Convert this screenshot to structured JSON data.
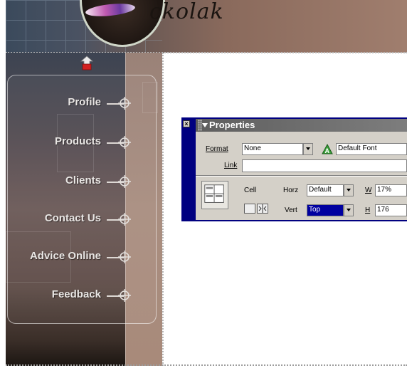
{
  "colors": {
    "panel_border": "#000080",
    "panel_face": "#d4d0c8",
    "titlebar": "#6e6e6e",
    "menu_text": "#e9e6e4",
    "selected_field": "#0000a0",
    "up_arrow": "#d32020"
  },
  "banner": {
    "logo_text": "ckolak"
  },
  "menu": {
    "items": [
      {
        "label": "Profile"
      },
      {
        "label": "Products"
      },
      {
        "label": "Clients"
      },
      {
        "label": "Contact Us"
      },
      {
        "label": "Advice Online"
      },
      {
        "label": "Feedback"
      }
    ]
  },
  "properties": {
    "title": "Properties",
    "close_glyph": "×",
    "format_label": "Format",
    "format_value": "None",
    "font_icon": "A",
    "font_value": "Default Font",
    "link_label": "Link",
    "link_value": "",
    "cell_label": "Cell",
    "horz_label": "Horz",
    "horz_value": "Default",
    "vert_label": "Vert",
    "vert_value": "Top",
    "w_label": "W",
    "w_value": "17%",
    "h_label": "H",
    "h_value": "176"
  },
  "icons": {
    "up_arrow": "up-arrow-icon",
    "crosshair": "crosshair-icon",
    "merge_cells": "merge-cells-icon",
    "split_cells": "split-cells-icon",
    "cell_layout": "cell-layout-icon",
    "font_color": "font-color-icon"
  }
}
